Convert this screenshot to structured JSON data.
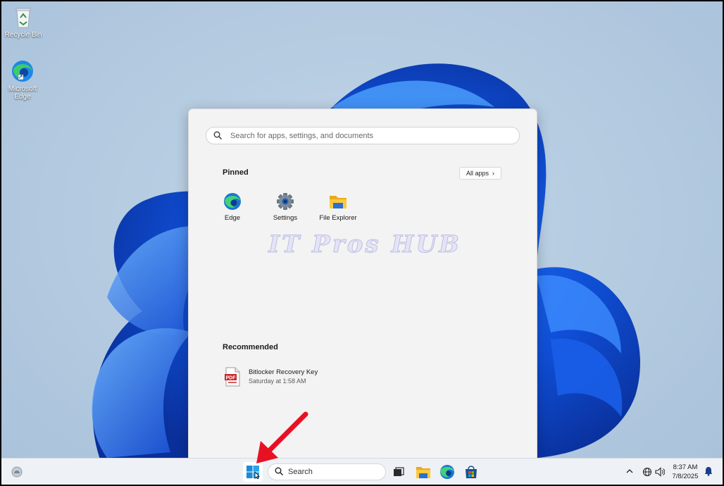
{
  "desktop": {
    "icons": [
      {
        "label": "Recycle Bin",
        "icon": "recycle-bin-icon"
      },
      {
        "label": "Microsoft\nEdge",
        "icon": "edge-icon"
      }
    ]
  },
  "start_menu": {
    "search": {
      "placeholder": "Search for apps, settings, and documents"
    },
    "pinned": {
      "title": "Pinned",
      "all_apps_label": "All apps",
      "apps": [
        {
          "label": "Edge",
          "icon": "edge-icon"
        },
        {
          "label": "Settings",
          "icon": "gear-icon"
        },
        {
          "label": "File Explorer",
          "icon": "folder-icon"
        }
      ]
    },
    "watermark": "IT Pros HUB",
    "recommended": {
      "title": "Recommended",
      "items": [
        {
          "name": "Bitlocker Recovery Key",
          "time": "Saturday at 1:58 AM",
          "icon": "pdf-icon"
        }
      ]
    }
  },
  "taskbar": {
    "search_label": "Search",
    "apps": [
      "start-icon",
      "task-view-icon",
      "folder-icon",
      "edge-icon",
      "store-icon"
    ],
    "clock": {
      "time": "8:37 AM",
      "date": "7/8/2025"
    }
  },
  "colors": {
    "accent": "#0067c0",
    "annotation_arrow": "#e81123"
  }
}
